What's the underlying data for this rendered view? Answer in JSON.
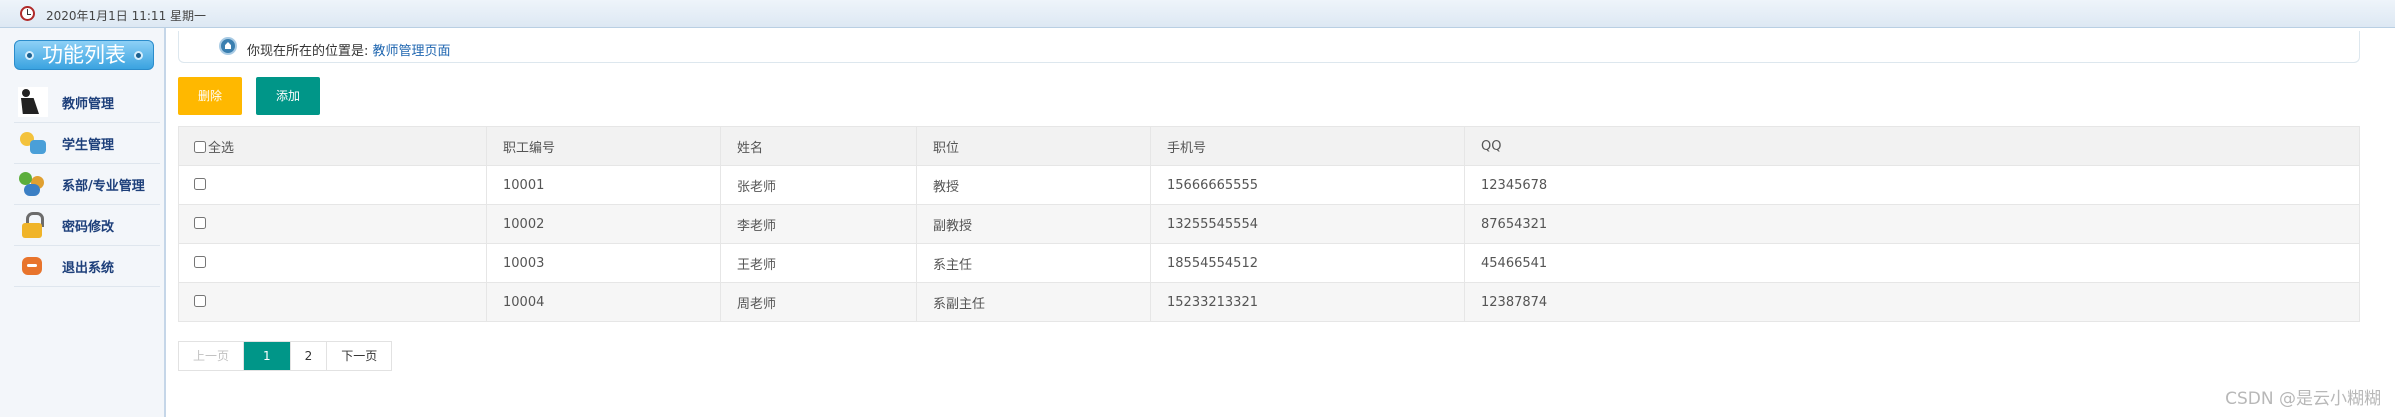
{
  "topbar": {
    "datetime": "2020年1月1日 11:11 星期一"
  },
  "sidebar": {
    "title": "功能列表",
    "items": [
      {
        "label": "教师管理",
        "icon": "teacher-icon"
      },
      {
        "label": "学生管理",
        "icon": "student-icon"
      },
      {
        "label": "系部/专业管理",
        "icon": "department-icon"
      },
      {
        "label": "密码修改",
        "icon": "lock-icon"
      },
      {
        "label": "退出系统",
        "icon": "exit-icon"
      }
    ]
  },
  "location": {
    "prefix": "你现在所在的位置是: ",
    "current": "教师管理页面"
  },
  "toolbar": {
    "delete_label": "删除",
    "add_label": "添加"
  },
  "table": {
    "select_all_label": "全选",
    "headers": [
      "职工编号",
      "姓名",
      "职位",
      "手机号",
      "QQ"
    ],
    "rows": [
      [
        "10001",
        "张老师",
        "教授",
        "15666665555",
        "12345678"
      ],
      [
        "10002",
        "李老师",
        "副教授",
        "13255545554",
        "87654321"
      ],
      [
        "10003",
        "王老师",
        "系主任",
        "18554554512",
        "45466541"
      ],
      [
        "10004",
        "周老师",
        "系副主任",
        "15233213321",
        "12387874"
      ]
    ]
  },
  "pager": {
    "prev": "上一页",
    "pages": [
      "1",
      "2"
    ],
    "current": "1",
    "next": "下一页"
  },
  "watermark": "CSDN @是云小糊糊",
  "colors": {
    "delete": "#ffb800",
    "add": "#009688",
    "pager_current": "#009688",
    "menu_text": "#1d3f7a"
  }
}
